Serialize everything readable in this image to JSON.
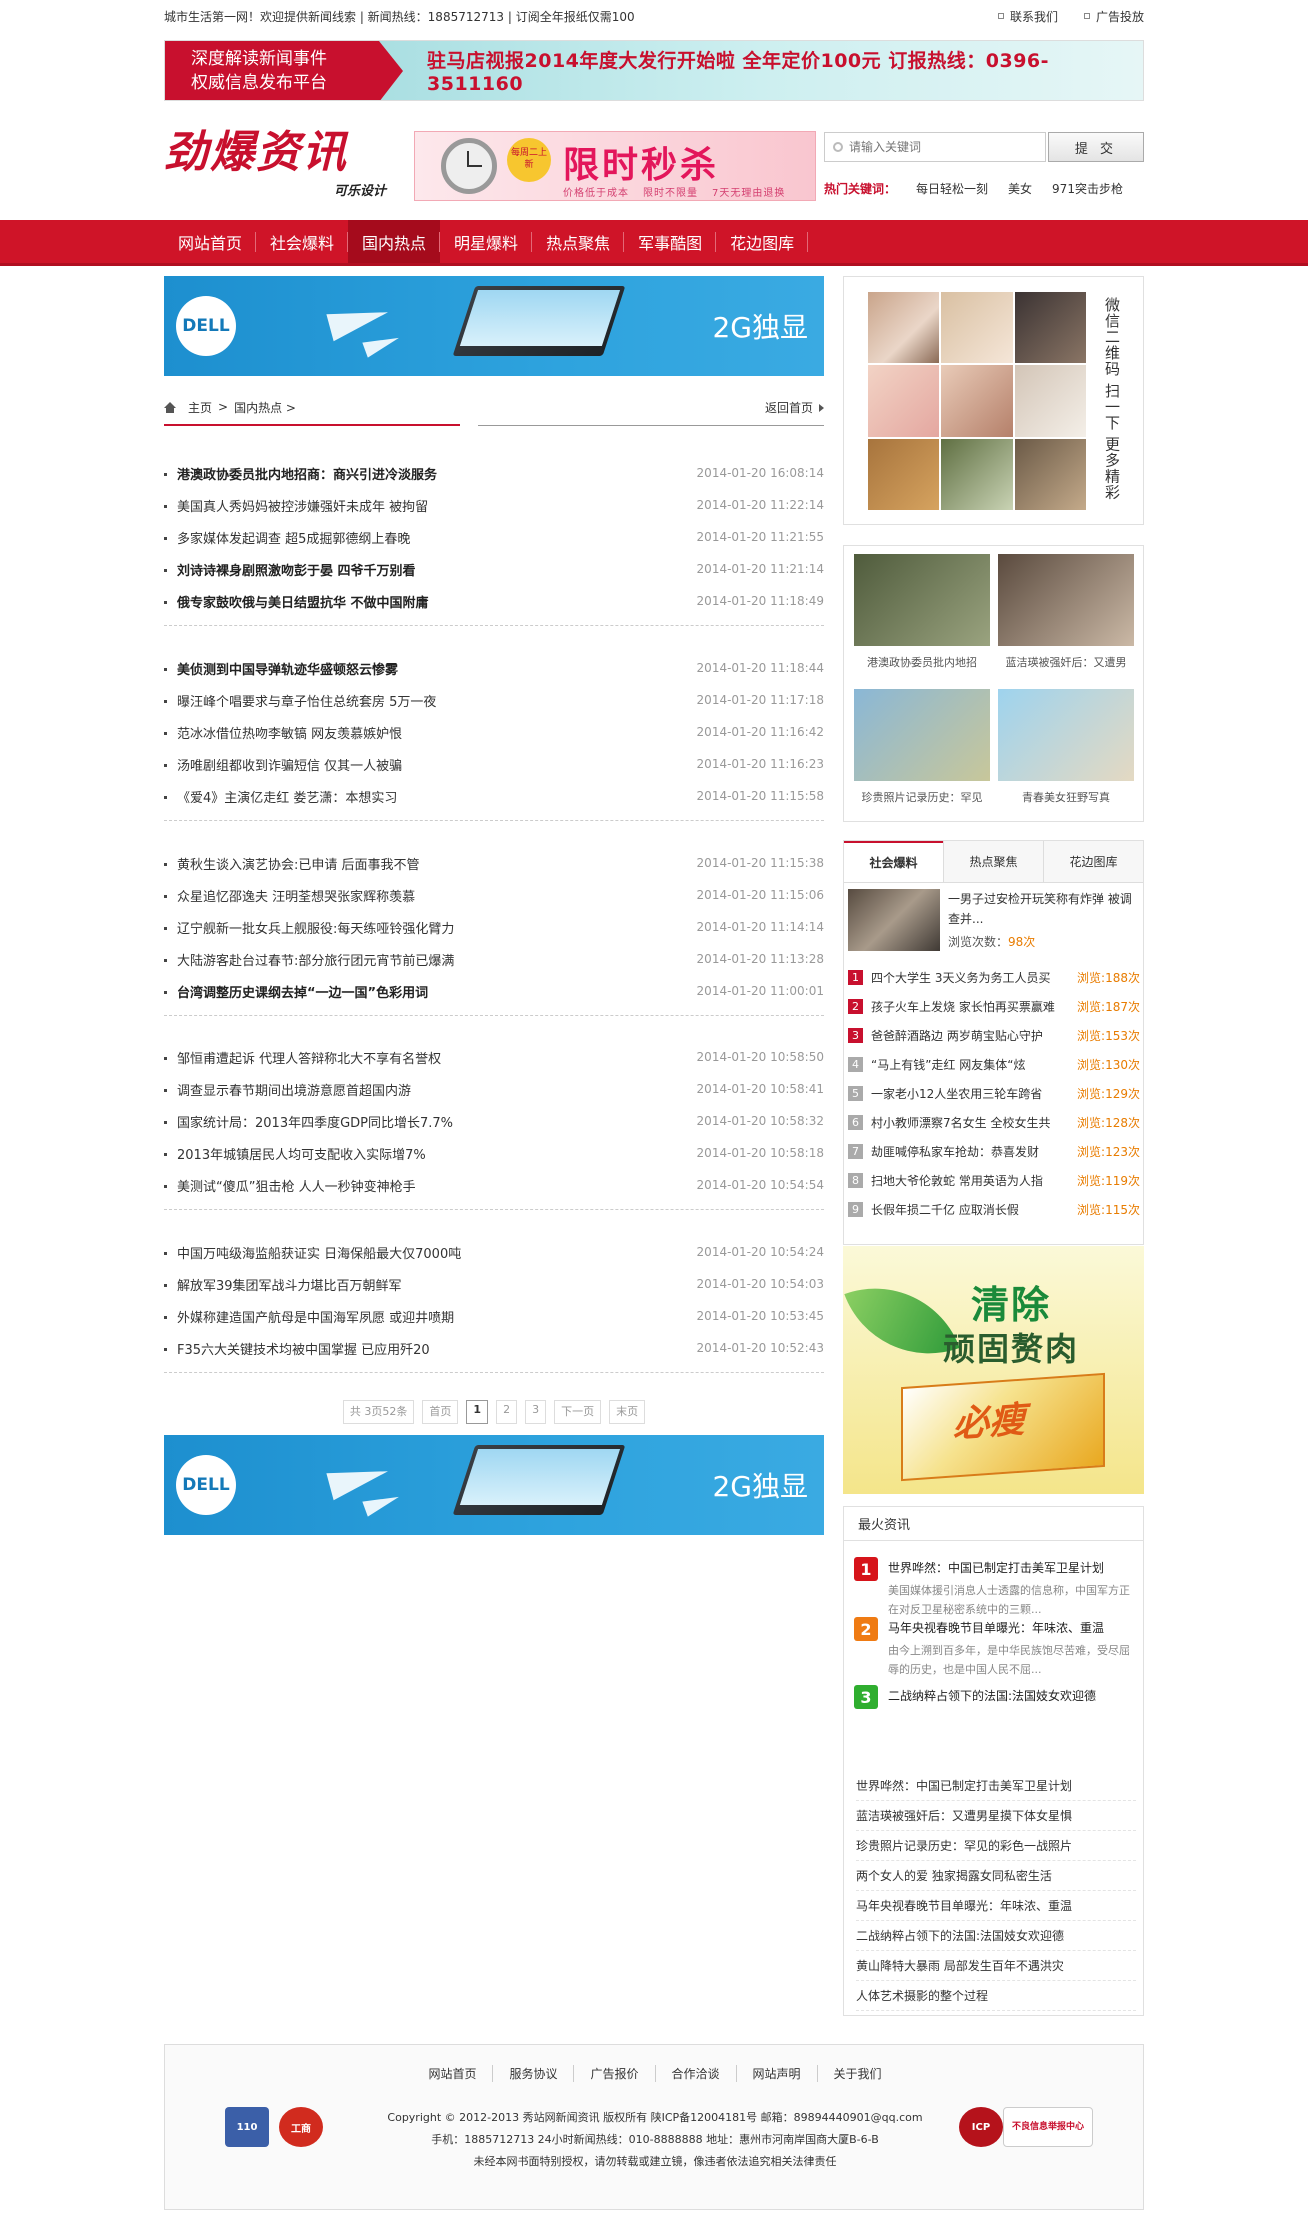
{
  "topbar": {
    "left": "城市生活第一网！欢迎提供新闻线索 | 新闻热线：1885712713 | 订阅全年报纸仅需100",
    "contact": "联系我们",
    "ads": "广告投放"
  },
  "banner": {
    "left_line1": "深度解读新闻事件",
    "left_line2": "权威信息发布平台",
    "right": "驻马店视报2014年度大发行开始啦  全年定价100元  订报热线：0396-3511160"
  },
  "logo": {
    "title": "劲爆资讯",
    "sub": "可乐设计"
  },
  "promo": {
    "tag": "每周二上新",
    "title": "限时秒杀",
    "sub": [
      "价格低于成本",
      "限时不限量",
      "7天无理由退换"
    ]
  },
  "search": {
    "placeholder": "请输入关键词",
    "submit": "提 交"
  },
  "hot_keywords": {
    "label": "热门关键词：",
    "items": [
      "每日轻松一刻",
      "美女",
      "971突击步枪"
    ]
  },
  "nav": {
    "items": [
      "网站首页",
      "社会爆料",
      "国内热点",
      "明星爆料",
      "热点聚焦",
      "军事酷图",
      "花边图库"
    ],
    "active": 2
  },
  "ad": {
    "logo": "DELL",
    "text": "2G独显"
  },
  "breadcrumb": {
    "home": "主页",
    "sep": ">",
    "current": "国内热点 >",
    "back": "返回首页"
  },
  "news_groups": [
    [
      {
        "title": "港澳政协委员批内地招商：商兴引进冷淡服务",
        "date": "2014-01-20 16:08:14",
        "bold": true
      },
      {
        "title": "美国真人秀妈妈被控涉嫌强奸未成年 被拘留",
        "date": "2014-01-20 11:22:14",
        "bold": false
      },
      {
        "title": "多家媒体发起调查 超5成掘郭德纲上春晚",
        "date": "2014-01-20 11:21:55",
        "bold": false
      },
      {
        "title": "刘诗诗裸身剧照激吻彭于晏 四爷千万别看",
        "date": "2014-01-20 11:21:14",
        "bold": true
      },
      {
        "title": "俄专家鼓吹俄与美日结盟抗华 不做中国附庸",
        "date": "2014-01-20 11:18:49",
        "bold": true
      }
    ],
    [
      {
        "title": "美侦测到中国导弹轨迹华盛顿怒云惨雾",
        "date": "2014-01-20 11:18:44",
        "bold": true
      },
      {
        "title": "曝汪峰个唱要求与章子怡住总统套房 5万一夜",
        "date": "2014-01-20 11:17:18",
        "bold": false
      },
      {
        "title": "范冰冰借位热吻李敏镐 网友羡慕嫉妒恨",
        "date": "2014-01-20 11:16:42",
        "bold": false
      },
      {
        "title": "汤唯剧组都收到诈骗短信 仅其一人被骗",
        "date": "2014-01-20 11:16:23",
        "bold": false
      },
      {
        "title": "《爱4》主演亿走红 娄艺潇：本想实习",
        "date": "2014-01-20 11:15:58",
        "bold": false
      }
    ],
    [
      {
        "title": "黄秋生谈入演艺协会:已申请 后面事我不管",
        "date": "2014-01-20 11:15:38",
        "bold": false
      },
      {
        "title": "众星追忆邵逸夫 汪明荃想哭张家辉称羡慕",
        "date": "2014-01-20 11:15:06",
        "bold": false
      },
      {
        "title": "辽宁舰新一批女兵上舰服役:每天练哑铃强化臂力",
        "date": "2014-01-20 11:14:14",
        "bold": false
      },
      {
        "title": "大陆游客赴台过春节:部分旅行团元宵节前已爆满",
        "date": "2014-01-20 11:13:28",
        "bold": false
      },
      {
        "title": "台湾调整历史课纲去掉“一边一国”色彩用词",
        "date": "2014-01-20 11:00:01",
        "bold": true
      }
    ],
    [
      {
        "title": "邹恒甫遭起诉 代理人答辩称北大不享有名誉权",
        "date": "2014-01-20 10:58:50",
        "bold": false
      },
      {
        "title": "调查显示春节期间出境游意愿首超国内游",
        "date": "2014-01-20 10:58:41",
        "bold": false
      },
      {
        "title": "国家统计局：2013年四季度GDP同比增长7.7%",
        "date": "2014-01-20 10:58:32",
        "bold": false
      },
      {
        "title": "2013年城镇居民人均可支配收入实际增7%",
        "date": "2014-01-20 10:58:18",
        "bold": false
      },
      {
        "title": "美测试“傻瓜”狙击枪 人人一秒钟变神枪手",
        "date": "2014-01-20 10:54:54",
        "bold": false
      }
    ],
    [
      {
        "title": "中国万吨级海监船获证实 日海保船最大仅7000吨",
        "date": "2014-01-20 10:54:24",
        "bold": false
      },
      {
        "title": "解放军39集团军战斗力堪比百万朝鲜军",
        "date": "2014-01-20 10:54:03",
        "bold": false
      },
      {
        "title": "外媒称建造国产航母是中国海军夙愿 或迎井喷期",
        "date": "2014-01-20 10:53:45",
        "bold": false
      },
      {
        "title": "F35六大关键技术均被中国掌握 已应用歼20",
        "date": "2014-01-20 10:52:43",
        "bold": false
      }
    ]
  ],
  "pager": {
    "total": "共 3页52条",
    "first": "首页",
    "pages": [
      "1",
      "2",
      "3"
    ],
    "next": "下一页",
    "last": "末页"
  },
  "qr": {
    "text": "微信二维码 扫一下 更多精彩"
  },
  "pics": [
    {
      "caption": "港澳政协委员批内地招",
      "colors": [
        "#4f5b3c",
        "#9aa37f"
      ]
    },
    {
      "caption": "蓝洁瑛被强奸后：又遭男",
      "colors": [
        "#5a4a3e",
        "#cbb9a6"
      ]
    },
    {
      "caption": "珍贵照片记录历史：罕见",
      "colors": [
        "#8ab7d6",
        "#c8c79a"
      ]
    },
    {
      "caption": "青春美女狂野写真",
      "colors": [
        "#9ed3ee",
        "#e4d9c2"
      ]
    }
  ],
  "tabs": {
    "labels": [
      "社会爆料",
      "热点聚焦",
      "花边图库"
    ],
    "feature": {
      "title": "一男子过安检开玩笑称有炸弹 被调查并...",
      "views_label": "浏览次数：",
      "views": "98次"
    },
    "list": [
      {
        "num": "1",
        "title": "四个大学生 3天义务为务工人员买",
        "views": "浏览:188次",
        "color": "#c8102e"
      },
      {
        "num": "2",
        "title": "孩子火车上发烧 家长怕再买票赢难",
        "views": "浏览:187次",
        "color": "#c8102e"
      },
      {
        "num": "3",
        "title": "爸爸醉酒路边 两岁萌宝贴心守护",
        "views": "浏览:153次",
        "color": "#c8102e"
      },
      {
        "num": "4",
        "title": "“马上有钱”走红 网友集体“炫",
        "views": "浏览:130次",
        "color": "#aaaaaa"
      },
      {
        "num": "5",
        "title": "一家老小12人坐农用三轮车跨省",
        "views": "浏览:129次",
        "color": "#aaaaaa"
      },
      {
        "num": "6",
        "title": "村小教师漂察7名女生 全校女生共",
        "views": "浏览:128次",
        "color": "#aaaaaa"
      },
      {
        "num": "7",
        "title": "劫匪喊停私家车抢劫：恭喜发财",
        "views": "浏览:123次",
        "color": "#aaaaaa"
      },
      {
        "num": "8",
        "title": "扫地大爷伦敦蛇 常用英语为人指",
        "views": "浏览:119次",
        "color": "#aaaaaa"
      },
      {
        "num": "9",
        "title": "长假年损二千亿 应取消长假",
        "views": "浏览:115次",
        "color": "#aaaaaa"
      }
    ]
  },
  "med_ad": {
    "line1": "清除",
    "line2": "顽固赘肉",
    "brand": "必瘦"
  },
  "hottest": {
    "title": "最火资讯",
    "top": [
      {
        "num": "1",
        "title": "世界哗然：中国已制定打击美军卫星计划",
        "summary": "美国媒体援引消息人士透露的信息称，中国军方正在对反卫星秘密系统中的三颗...",
        "color": "#d6141a"
      },
      {
        "num": "2",
        "title": "马年央视春晚节目单曝光：年味浓、重温",
        "summary": "由今上溯到百多年，是中华民族饱尽苦难，受尽屈辱的历史，也是中国人民不屈...",
        "color": "#ef7b13"
      },
      {
        "num": "3",
        "title": "二战纳粹占领下的法国:法国妓女欢迎德",
        "summary": "",
        "color": "#2fae2f"
      }
    ],
    "list": [
      "世界哗然：中国已制定打击美军卫星计划",
      "蓝洁瑛被强奸后：又遭男星摸下体女星惧",
      "珍贵照片记录历史：罕见的彩色一战照片",
      "两个女人的爱 独家揭露女同私密生活",
      "马年央视春晚节目单曝光：年味浓、重温",
      "二战纳粹占领下的法国:法国妓女欢迎德",
      "黄山降特大暴雨 局部发生百年不遇洪灾",
      "人体艺术摄影的整个过程"
    ]
  },
  "footer": {
    "links": [
      "网站首页",
      "服务协议",
      "广告报价",
      "合作洽谈",
      "网站声明",
      "关于我们"
    ],
    "copyright": "Copyright © 2012-2013 秀站网新闻资讯 版权所有 陕ICP备12004181号 邮箱：89894440901@qq.com",
    "contact": "手机：1885712713 24小时新闻热线：010-8888888 地址：惠州市河南岸国商大厦B-6-B",
    "notice": "未经本网书面特别授权，请勿转载或建立镜，像违者依法追究相关法律责任",
    "badges": [
      "110",
      "工商",
      "ICP",
      "不良信息举报中心"
    ]
  }
}
